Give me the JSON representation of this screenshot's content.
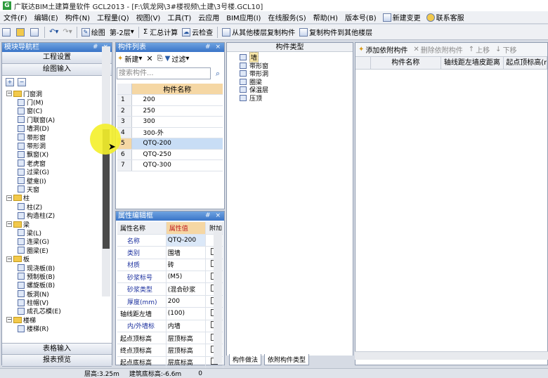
{
  "window": {
    "title": "广联达BIM土建算量软件 GCL2013 - [F:\\筑龙网\\3#楼视频\\土建\\3号楼.GCL10]",
    "logo": "G"
  },
  "menu": [
    "文件(F)",
    "编辑(E)",
    "构件(N)",
    "工程量(Q)",
    "视图(V)",
    "工具(T)",
    "云应用",
    "BIM应用(I)",
    "在线服务(S)",
    "帮助(H)",
    "版本号(B)"
  ],
  "menu_actions": {
    "new_change": "新建变更",
    "support": "联系客服"
  },
  "toolbar": {
    "draw": "绘图",
    "floor": "第-2层",
    "sum": "汇总计算",
    "cloud_check": "云检查",
    "copy_from": "从其他楼层复制构件",
    "copy_to": "复制构件到其他楼层"
  },
  "nav": {
    "title": "模块导航栏",
    "pin": "# ×",
    "top_buttons": [
      "工程设置",
      "绘图输入"
    ],
    "bottom_buttons": [
      "表格输入",
      "报表预览"
    ],
    "tree": [
      {
        "label": "门窗洞",
        "level": 0,
        "folder": true,
        "exp": "−"
      },
      {
        "label": "门(M)",
        "level": 1
      },
      {
        "label": "窗(C)",
        "level": 1
      },
      {
        "label": "门联窗(A)",
        "level": 1
      },
      {
        "label": "墙洞(D)",
        "level": 1
      },
      {
        "label": "带形窗",
        "level": 1
      },
      {
        "label": "带形洞",
        "level": 1
      },
      {
        "label": "飘窗(X)",
        "level": 1
      },
      {
        "label": "老虎窗",
        "level": 1
      },
      {
        "label": "过梁(G)",
        "level": 1
      },
      {
        "label": "壁龛(I)",
        "level": 1
      },
      {
        "label": "天窗",
        "level": 1
      },
      {
        "label": "柱",
        "level": 0,
        "folder": true,
        "exp": "−"
      },
      {
        "label": "柱(Z)",
        "level": 1
      },
      {
        "label": "构造柱(Z)",
        "level": 1
      },
      {
        "label": "梁",
        "level": 0,
        "folder": true,
        "exp": "−"
      },
      {
        "label": "梁(L)",
        "level": 1
      },
      {
        "label": "连梁(G)",
        "level": 1
      },
      {
        "label": "圈梁(E)",
        "level": 1
      },
      {
        "label": "板",
        "level": 0,
        "folder": true,
        "exp": "−"
      },
      {
        "label": "现浇板(B)",
        "level": 1
      },
      {
        "label": "预制板(B)",
        "level": 1
      },
      {
        "label": "螺旋板(B)",
        "level": 1
      },
      {
        "label": "板洞(N)",
        "level": 1
      },
      {
        "label": "柱帽(V)",
        "level": 1
      },
      {
        "label": "成孔芯模(E)",
        "level": 1
      },
      {
        "label": "楼梯",
        "level": 0,
        "folder": true,
        "exp": "−"
      },
      {
        "label": "楼梯(R)",
        "level": 1
      }
    ]
  },
  "components": {
    "title": "构件列表",
    "pin": "# ×",
    "new_label": "新建",
    "filter_label": "过滤",
    "search_placeholder": "搜索构件...",
    "column": "构件名称",
    "rows": [
      {
        "n": "1",
        "name": "200"
      },
      {
        "n": "2",
        "name": "250"
      },
      {
        "n": "3",
        "name": "300"
      },
      {
        "n": "4",
        "name": "300-外"
      },
      {
        "n": "5",
        "name": "QTQ-200",
        "selected": true
      },
      {
        "n": "6",
        "name": "QTQ-250"
      },
      {
        "n": "7",
        "name": "QTQ-300"
      }
    ]
  },
  "properties": {
    "title": "属性编辑框",
    "pin": "# ×",
    "headers": [
      "属性名称",
      "属性值",
      "附加"
    ],
    "rows": [
      {
        "name": "名称",
        "value": "QTQ-200",
        "check": false,
        "blue": true
      },
      {
        "name": "类别",
        "value": "围墙",
        "check": true,
        "blue": true
      },
      {
        "name": "材质",
        "value": "砖",
        "check": true,
        "blue": true
      },
      {
        "name": "砂浆标号",
        "value": "(M5)",
        "check": true,
        "blue": true
      },
      {
        "name": "砂浆类型",
        "value": "(混合砂浆",
        "check": true,
        "blue": true
      },
      {
        "name": "厚度(mm)",
        "value": "200",
        "check": true,
        "blue": true
      },
      {
        "name": "轴线距左墙",
        "value": "(100)",
        "check": true,
        "blue": false
      },
      {
        "name": "内/外墙标",
        "value": "内墙",
        "check": true,
        "blue": true
      },
      {
        "name": "起点顶标高",
        "value": "层顶标高",
        "check": true,
        "blue": false
      },
      {
        "name": "终点顶标高",
        "value": "层顶标高",
        "check": true,
        "blue": false
      },
      {
        "name": "起点底标高",
        "value": "层底标高",
        "check": true,
        "blue": false
      }
    ]
  },
  "component_types": {
    "title": "构件类型",
    "items": [
      "墙",
      "带形窗",
      "带形洞",
      "圈梁",
      "保温层",
      "压顶"
    ],
    "selected": "墙",
    "tabs": [
      "构件做法",
      "依附构件类型"
    ]
  },
  "attach": {
    "buttons": {
      "add": "添加依附构件",
      "remove": "删除依附构件",
      "up": "上移",
      "down": "下移"
    },
    "columns": [
      "构件名称",
      "轴线距左墙皮距离",
      "起点顶标高(m"
    ]
  },
  "status": {
    "floor_height": "层高:3.25m",
    "base_elev": "建筑底标高:-6.6m",
    "value": "0"
  }
}
